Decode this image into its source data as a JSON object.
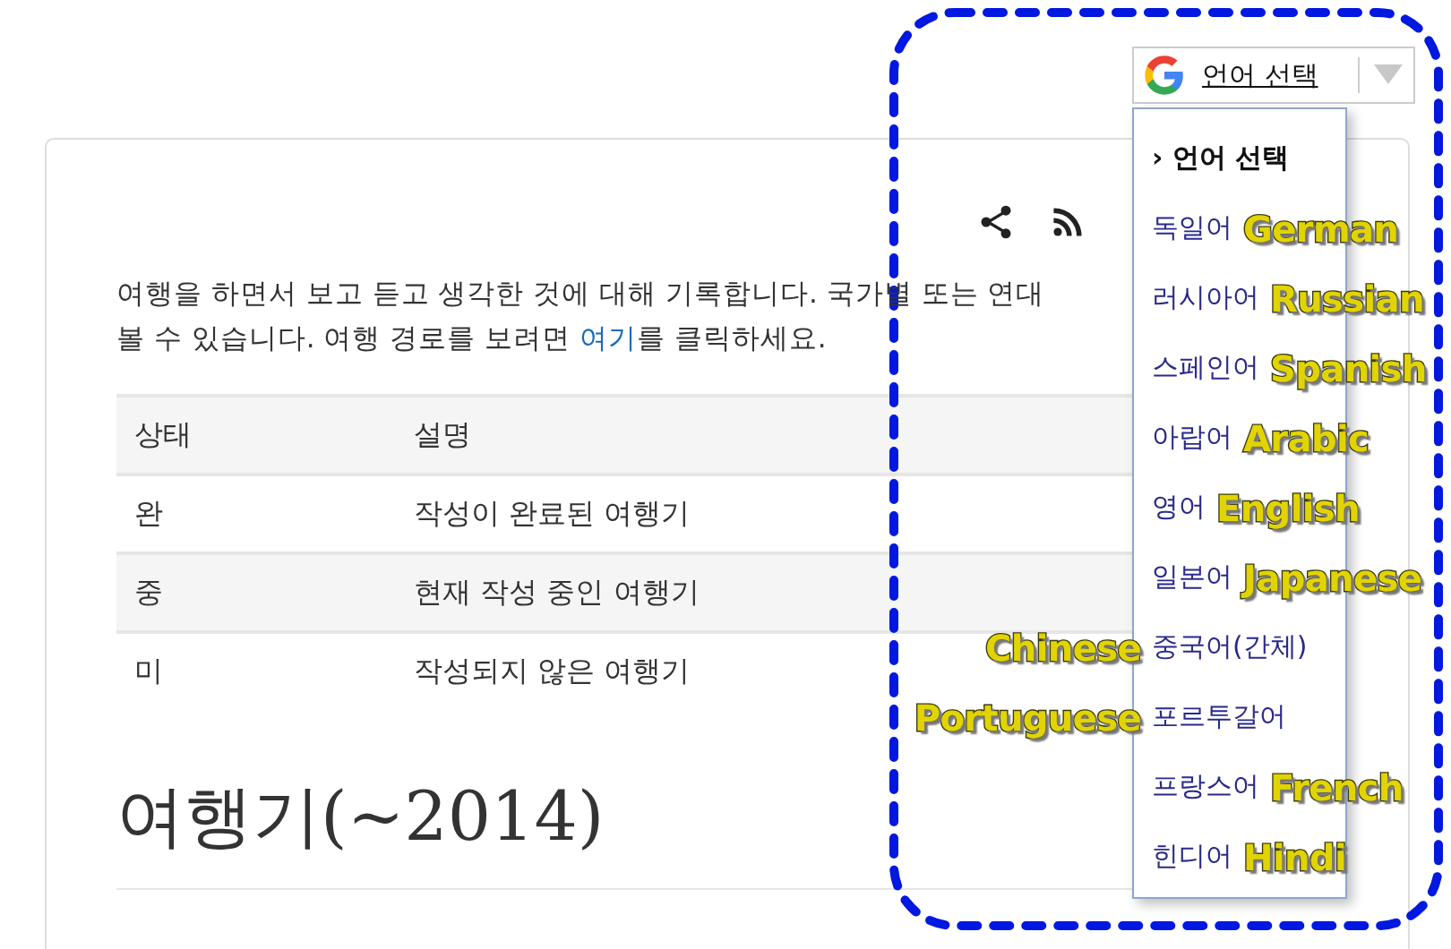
{
  "language_selector": {
    "label": "언어 선택"
  },
  "paragraph": {
    "line1": "여행을 하면서 보고 듣고 생각한 것에 대해 기록합니다. 국가별 또는 연대",
    "line2_before": "볼 수 있습니다. 여행 경로를 보려면 ",
    "link": "여기",
    "line2_after": "를 클릭하세요."
  },
  "table": {
    "columns": [
      "상태",
      "설명"
    ],
    "rows": [
      [
        "완",
        "작성이 완료된 여행기"
      ],
      [
        "중",
        "현재 작성 중인 여행기"
      ],
      [
        "미",
        "작성되지 않은 여행기"
      ]
    ]
  },
  "heading": "여행기(~2014)",
  "language_menu": [
    {
      "kind": "header",
      "label": "› 언어 선택"
    },
    {
      "kind": "item",
      "label": "독일어",
      "annotation": {
        "text": "German",
        "kind": "right"
      }
    },
    {
      "kind": "item",
      "label": "러시아어",
      "annotation": {
        "text": "Russian",
        "kind": "right"
      }
    },
    {
      "kind": "item",
      "label": "스페인어",
      "annotation": {
        "text": "Spanish",
        "kind": "right"
      }
    },
    {
      "kind": "item",
      "label": "아랍어",
      "annotation": {
        "text": "Arabic",
        "kind": "right"
      }
    },
    {
      "kind": "item",
      "label": "영어",
      "annotation": {
        "text": "English",
        "kind": "right"
      }
    },
    {
      "kind": "item",
      "label": "일본어",
      "annotation": {
        "text": "Japanese",
        "kind": "right"
      }
    },
    {
      "kind": "item",
      "label": "중국어(간체)",
      "annotation": {
        "text": "Chinese",
        "kind": "left"
      }
    },
    {
      "kind": "item",
      "label": "포르투갈어",
      "annotation": {
        "text": "Portuguese",
        "kind": "left"
      }
    },
    {
      "kind": "item",
      "label": "프랑스어",
      "annotation": {
        "text": "French",
        "kind": "right"
      }
    },
    {
      "kind": "item",
      "label": "힌디어",
      "annotation": {
        "text": "Hindi",
        "kind": "right"
      }
    }
  ]
}
